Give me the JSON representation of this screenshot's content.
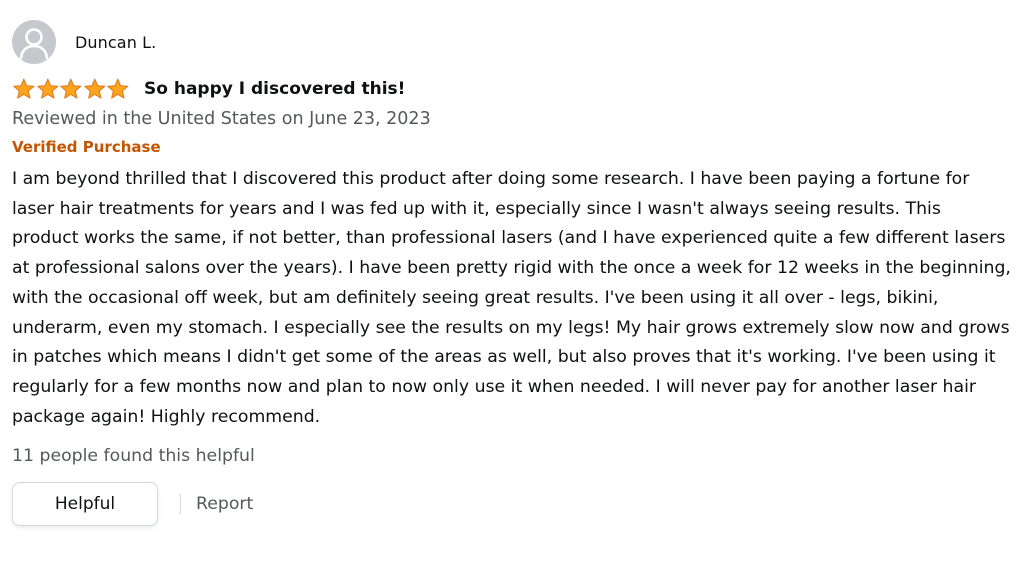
{
  "review": {
    "profile": {
      "name": "Duncan L.",
      "avatar_icon": "person-silhouette-icon"
    },
    "rating": {
      "value": 5,
      "max": 5,
      "star_color": "#ffa41c",
      "star_icon": "star-icon"
    },
    "title": "So happy I discovered this!",
    "date_line": "Reviewed in the United States on June 23, 2023",
    "verified_label": "Verified Purchase",
    "body": "I am beyond thrilled that I discovered this product after doing some research. I have been paying a fortune for laser hair treatments for years and I was fed up with it, especially since I wasn't always seeing results. This product works the same, if not better, than professional lasers (and I have experienced quite a few different lasers at professional salons over the years). I have been pretty rigid with the once a week for 12 weeks in the beginning, with the occasional off week, but am definitely seeing great results. I've been using it all over - legs, bikini, underarm, even my stomach. I especially see the results on my legs! My hair grows extremely slow now and grows in patches which means I didn't get some of the areas as well, but also proves that it's working. I've been using it regularly for a few months now and plan to now only use it when needed. I will never pay for another laser hair package again! Highly recommend.",
    "helpful_count_text": "11 people found this helpful",
    "actions": {
      "helpful_label": "Helpful",
      "report_label": "Report"
    }
  },
  "colors": {
    "text": "#0f1111",
    "secondary_text": "#565959",
    "verified": "#c45500",
    "border": "#d5d9d9"
  }
}
